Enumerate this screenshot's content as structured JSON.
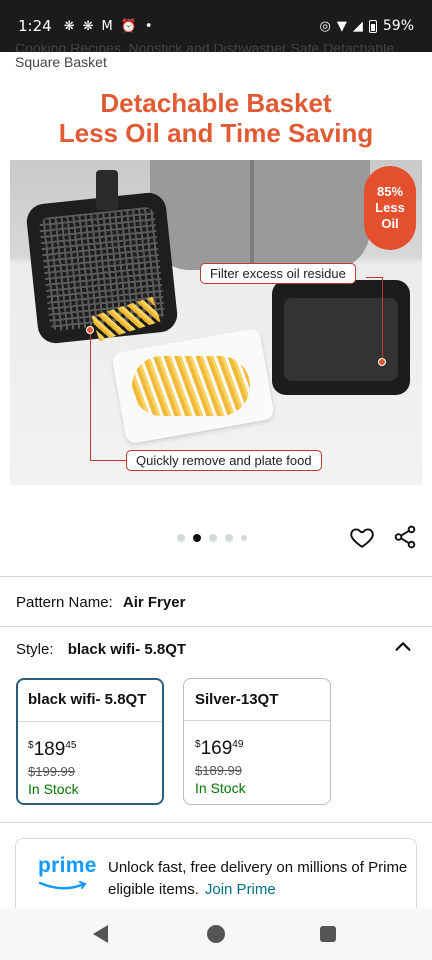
{
  "status_bar": {
    "time": "1:24",
    "battery": "59%",
    "left_icons": [
      "leaf-notification-icon",
      "leaf-notification-icon",
      "gmail-icon",
      "alarm-icon",
      "dot-icon"
    ],
    "right_icons": [
      "hotspot-icon",
      "wifi-icon",
      "signal-icon",
      "battery-icon"
    ]
  },
  "product": {
    "title_line1": "Cooking Recipes, Nonstick and Dishwasher Safe Detachable",
    "title_line2": "Square Basket"
  },
  "hero_image": {
    "headline_line1": "Detachable Basket",
    "headline_line2": "Less Oil and Time Saving",
    "badge_line1": "85%",
    "badge_line2": "Less",
    "badge_line3": "Oil",
    "callout_top": "Filter excess oil residue",
    "callout_bottom": "Quickly remove and plate food",
    "accent_color": "#e05a33"
  },
  "carousel": {
    "dot_count": 5,
    "active_index": 1,
    "favorite_icon": "heart-outline-icon",
    "share_icon": "share-icon"
  },
  "pattern": {
    "label": "Pattern Name:",
    "value": "Air Fryer"
  },
  "style": {
    "label": "Style:",
    "value": "black wifi- 5.8QT",
    "collapse_icon": "chevron-up-icon"
  },
  "options": [
    {
      "title": "black wifi- 5.8QT",
      "price_currency": "$",
      "price_whole": "189",
      "price_fraction": "45",
      "list_price": "$199.99",
      "availability": "In Stock",
      "selected": true
    },
    {
      "title": "Silver-13QT",
      "price_currency": "$",
      "price_whole": "169",
      "price_fraction": "49",
      "list_price": "$189.99",
      "availability": "In Stock",
      "selected": false
    }
  ],
  "prime": {
    "logo_text": "prime",
    "message": "Unlock fast, free delivery on millions of Prime eligible items.",
    "link": "Join Prime",
    "brand_color": "#1399ff"
  },
  "colors": {
    "selected_border": "#2a5d7e",
    "in_stock": "#007600",
    "link": "#007185"
  }
}
